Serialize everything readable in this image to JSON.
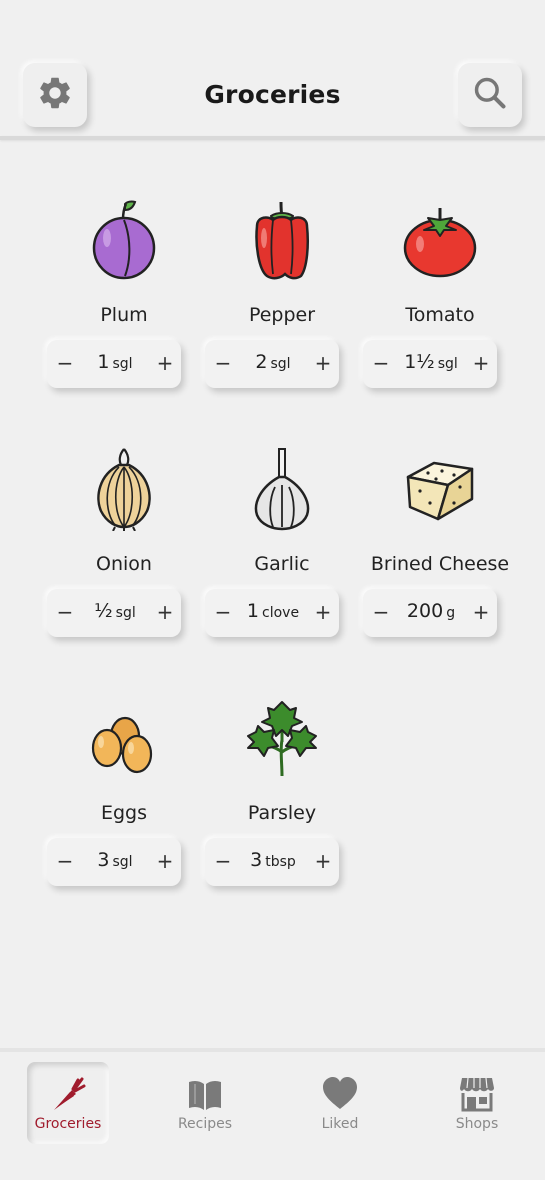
{
  "header": {
    "title": "Groceries",
    "settings_icon": "gear-icon",
    "search_icon": "search-icon"
  },
  "items": [
    {
      "name": "Plum",
      "qty": "1",
      "unit": "sgl",
      "icon": "plum-icon"
    },
    {
      "name": "Pepper",
      "qty": "2",
      "unit": "sgl",
      "icon": "pepper-icon"
    },
    {
      "name": "Tomato",
      "qty": "1½",
      "unit": "sgl",
      "icon": "tomato-icon"
    },
    {
      "name": "Onion",
      "qty": "½",
      "unit": "sgl",
      "icon": "onion-icon"
    },
    {
      "name": "Garlic",
      "qty": "1",
      "unit": "clove",
      "icon": "garlic-icon"
    },
    {
      "name": "Brined Cheese",
      "qty": "200",
      "unit": "g",
      "icon": "cheese-icon"
    },
    {
      "name": "Eggs",
      "qty": "3",
      "unit": "sgl",
      "icon": "eggs-icon"
    },
    {
      "name": "Parsley",
      "qty": "3",
      "unit": "tbsp",
      "icon": "parsley-icon"
    }
  ],
  "stepper": {
    "minus": "−",
    "plus": "+"
  },
  "nav": {
    "items": [
      {
        "label": "Groceries",
        "icon": "carrot-icon",
        "active": true
      },
      {
        "label": "Recipes",
        "icon": "book-icon",
        "active": false
      },
      {
        "label": "Liked",
        "icon": "heart-icon",
        "active": false
      },
      {
        "label": "Shops",
        "icon": "shop-icon",
        "active": false
      }
    ]
  },
  "colors": {
    "background": "#f0f0f0",
    "accent": "#a01c2d",
    "inactive_nav": "#8a8a8a"
  }
}
